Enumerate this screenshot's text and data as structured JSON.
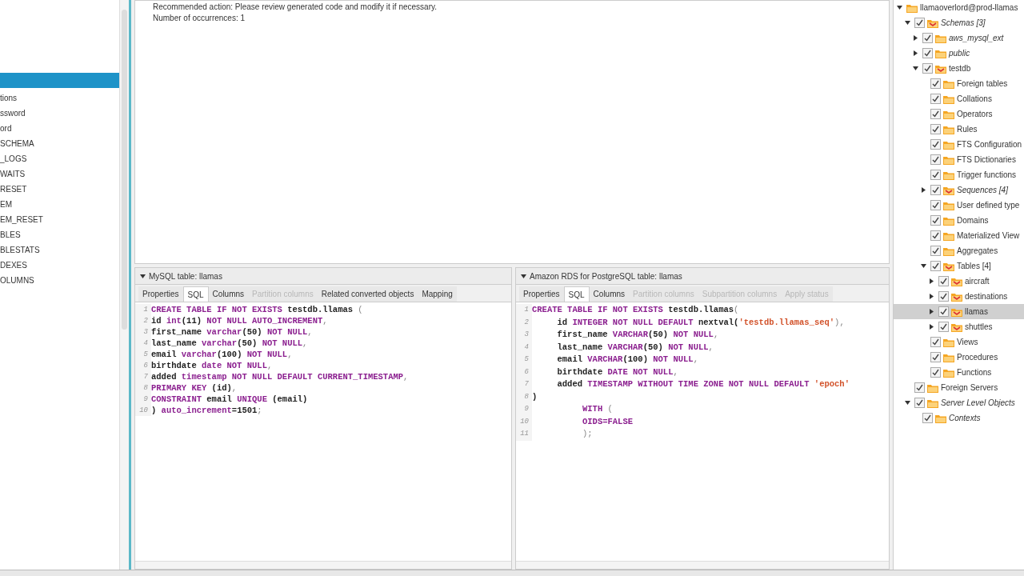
{
  "left_list": {
    "items": [
      {
        "selected": true
      },
      {
        "label": "tions",
        "selected": false
      },
      {
        "label": "ssword",
        "selected": false
      },
      {
        "label": "ord",
        "selected": false
      },
      {
        "label": "SCHEMA",
        "selected": false
      },
      {
        "label": "_LOGS",
        "selected": false
      },
      {
        "label": "WAITS",
        "selected": false
      },
      {
        "label": "RESET",
        "selected": false
      },
      {
        "label": "EM",
        "selected": false
      },
      {
        "label": "EM_RESET",
        "selected": false
      },
      {
        "label": "BLES",
        "selected": false
      },
      {
        "label": "BLESTATS",
        "selected": false
      },
      {
        "label": "DEXES",
        "selected": false
      },
      {
        "label": "OLUMNS",
        "selected": false
      }
    ]
  },
  "message": {
    "lines": [
      "Recommended action: Please review generated code and modify it if necessary.",
      "Number of occurrences: 1"
    ]
  },
  "source_panel": {
    "title": "MySQL table: llamas",
    "expanded": true,
    "tabs": [
      {
        "label": "Properties",
        "selected": false,
        "disabled": false
      },
      {
        "label": "SQL",
        "selected": true,
        "disabled": false
      },
      {
        "label": "Columns",
        "selected": false,
        "disabled": false
      },
      {
        "label": "Partition columns",
        "selected": false,
        "disabled": true
      },
      {
        "label": "Related converted objects",
        "selected": false,
        "disabled": false
      },
      {
        "label": "Mapping",
        "selected": false,
        "disabled": false
      }
    ],
    "code": [
      {
        "number": "1",
        "tokens": [
          {
            "text": "CREATE TABLE IF NOT EXISTS",
            "kind": "keyword"
          },
          {
            "text": " testdb.llamas ",
            "kind": "ident"
          },
          {
            "text": "(",
            "kind": "punct"
          }
        ]
      },
      {
        "number": "2",
        "tokens": [
          {
            "text": "id ",
            "kind": "ident"
          },
          {
            "text": "int",
            "kind": "keyword"
          },
          {
            "text": "(11) ",
            "kind": "ident"
          },
          {
            "text": "NOT NULL AUTO_INCREMENT",
            "kind": "keyword"
          },
          {
            "text": ",",
            "kind": "punct"
          }
        ]
      },
      {
        "number": "3",
        "tokens": [
          {
            "text": "first_name ",
            "kind": "ident"
          },
          {
            "text": "varchar",
            "kind": "keyword"
          },
          {
            "text": "(50) ",
            "kind": "ident"
          },
          {
            "text": "NOT NULL",
            "kind": "keyword"
          },
          {
            "text": ",",
            "kind": "punct"
          }
        ]
      },
      {
        "number": "4",
        "tokens": [
          {
            "text": "last_name ",
            "kind": "ident"
          },
          {
            "text": "varchar",
            "kind": "keyword"
          },
          {
            "text": "(50) ",
            "kind": "ident"
          },
          {
            "text": "NOT NULL",
            "kind": "keyword"
          },
          {
            "text": ",",
            "kind": "punct"
          }
        ]
      },
      {
        "number": "5",
        "tokens": [
          {
            "text": "email ",
            "kind": "ident"
          },
          {
            "text": "varchar",
            "kind": "keyword"
          },
          {
            "text": "(100) ",
            "kind": "ident"
          },
          {
            "text": "NOT NULL",
            "kind": "keyword"
          },
          {
            "text": ",",
            "kind": "punct"
          }
        ]
      },
      {
        "number": "6",
        "tokens": [
          {
            "text": "birthdate ",
            "kind": "ident"
          },
          {
            "text": "date NOT NULL",
            "kind": "keyword"
          },
          {
            "text": ",",
            "kind": "punct"
          }
        ]
      },
      {
        "number": "7",
        "tokens": [
          {
            "text": "added ",
            "kind": "ident"
          },
          {
            "text": "timestamp NOT NULL DEFAULT CURRENT_TIMESTAMP",
            "kind": "keyword"
          },
          {
            "text": ",",
            "kind": "punct"
          }
        ]
      },
      {
        "number": "8",
        "tokens": [
          {
            "text": "PRIMARY KEY",
            "kind": "keyword"
          },
          {
            "text": " (id)",
            "kind": "ident"
          },
          {
            "text": ",",
            "kind": "punct"
          }
        ]
      },
      {
        "number": "9",
        "tokens": [
          {
            "text": "CONSTRAINT",
            "kind": "keyword"
          },
          {
            "text": " email ",
            "kind": "ident"
          },
          {
            "text": "UNIQUE",
            "kind": "keyword"
          },
          {
            "text": " (email)",
            "kind": "ident"
          }
        ]
      },
      {
        "number": "10",
        "tokens": [
          {
            "text": ") ",
            "kind": "ident"
          },
          {
            "text": "auto_increment",
            "kind": "keyword"
          },
          {
            "text": "=1501",
            "kind": "ident"
          },
          {
            "text": ";",
            "kind": "punct"
          }
        ]
      }
    ]
  },
  "target_panel": {
    "title": "Amazon RDS for PostgreSQL table: llamas",
    "expanded": true,
    "tabs": [
      {
        "label": "Properties",
        "selected": false,
        "disabled": false
      },
      {
        "label": "SQL",
        "selected": true,
        "disabled": false
      },
      {
        "label": "Columns",
        "selected": false,
        "disabled": false
      },
      {
        "label": "Partition columns",
        "selected": false,
        "disabled": true
      },
      {
        "label": "Subpartition columns",
        "selected": false,
        "disabled": true
      },
      {
        "label": "Apply status",
        "selected": false,
        "disabled": true
      }
    ],
    "code": [
      {
        "number": "1",
        "tokens": [
          {
            "text": "CREATE TABLE IF NOT EXISTS",
            "kind": "keyword"
          },
          {
            "text": " testdb.llamas",
            "kind": "ident"
          },
          {
            "text": "(",
            "kind": "punct"
          }
        ]
      },
      {
        "number": "2",
        "tokens": [
          {
            "text": "     id ",
            "kind": "ident"
          },
          {
            "text": "INTEGER NOT NULL DEFAULT",
            "kind": "keyword"
          },
          {
            "text": " nextval(",
            "kind": "ident"
          },
          {
            "text": "'testdb.llamas_seq'",
            "kind": "string"
          },
          {
            "text": "),",
            "kind": "punct"
          }
        ]
      },
      {
        "number": "3",
        "tokens": [
          {
            "text": "     first_name ",
            "kind": "ident"
          },
          {
            "text": "VARCHAR",
            "kind": "keyword"
          },
          {
            "text": "(50) ",
            "kind": "ident"
          },
          {
            "text": "NOT NULL",
            "kind": "keyword"
          },
          {
            "text": ",",
            "kind": "punct"
          }
        ]
      },
      {
        "number": "4",
        "tokens": [
          {
            "text": "     last_name ",
            "kind": "ident"
          },
          {
            "text": "VARCHAR",
            "kind": "keyword"
          },
          {
            "text": "(50) ",
            "kind": "ident"
          },
          {
            "text": "NOT NULL",
            "kind": "keyword"
          },
          {
            "text": ",",
            "kind": "punct"
          }
        ]
      },
      {
        "number": "5",
        "tokens": [
          {
            "text": "     email ",
            "kind": "ident"
          },
          {
            "text": "VARCHAR",
            "kind": "keyword"
          },
          {
            "text": "(100) ",
            "kind": "ident"
          },
          {
            "text": "NOT NULL",
            "kind": "keyword"
          },
          {
            "text": ",",
            "kind": "punct"
          }
        ]
      },
      {
        "number": "6",
        "tokens": [
          {
            "text": "     birthdate ",
            "kind": "ident"
          },
          {
            "text": "DATE NOT NULL",
            "kind": "keyword"
          },
          {
            "text": ",",
            "kind": "punct"
          }
        ]
      },
      {
        "number": "7",
        "tokens": [
          {
            "text": "     added ",
            "kind": "ident"
          },
          {
            "text": "TIMESTAMP WITHOUT TIME ZONE NOT NULL DEFAULT",
            "kind": "keyword"
          },
          {
            "text": " 'epoch'",
            "kind": "string"
          }
        ]
      },
      {
        "number": "8",
        "tokens": [
          {
            "text": ")",
            "kind": "ident"
          }
        ]
      },
      {
        "number": "9",
        "tokens": [
          {
            "text": "          WITH",
            "kind": "keyword"
          },
          {
            "text": " (",
            "kind": "punct"
          }
        ]
      },
      {
        "number": "10",
        "tokens": [
          {
            "text": "          OIDS=FALSE",
            "kind": "keyword"
          }
        ]
      },
      {
        "number": "11",
        "tokens": [
          {
            "text": "          );",
            "kind": "punct"
          }
        ]
      }
    ]
  },
  "tree": [
    {
      "label": "llamaoverlord@prod-llamas",
      "expanded": true,
      "converted": false,
      "italic": false,
      "selected": false,
      "children": [
        {
          "label": "Schemas [3]",
          "expanded": true,
          "checked": true,
          "converted": true,
          "italic": true,
          "selected": false,
          "children": [
            {
              "label": "aws_mysql_ext",
              "expanded": false,
              "checked": true,
              "converted": false,
              "italic": true,
              "selected": false
            },
            {
              "label": "public",
              "expanded": false,
              "checked": true,
              "converted": false,
              "italic": true,
              "selected": false
            },
            {
              "label": "testdb",
              "expanded": true,
              "checked": true,
              "converted": true,
              "italic": false,
              "selected": false,
              "children": [
                {
                  "label": "Foreign tables",
                  "checked": true,
                  "converted": false,
                  "italic": false,
                  "selected": false
                },
                {
                  "label": "Collations",
                  "checked": true,
                  "converted": false,
                  "italic": false,
                  "selected": false
                },
                {
                  "label": "Operators",
                  "checked": true,
                  "converted": false,
                  "italic": false,
                  "selected": false
                },
                {
                  "label": "Rules",
                  "checked": true,
                  "converted": false,
                  "italic": false,
                  "selected": false
                },
                {
                  "label": "FTS Configuration",
                  "checked": true,
                  "converted": false,
                  "italic": false,
                  "selected": false
                },
                {
                  "label": "FTS Dictionaries",
                  "checked": true,
                  "converted": false,
                  "italic": false,
                  "selected": false
                },
                {
                  "label": "Trigger functions",
                  "checked": true,
                  "converted": false,
                  "italic": false,
                  "selected": false
                },
                {
                  "label": "Sequences [4]",
                  "expanded": false,
                  "checked": true,
                  "converted": true,
                  "italic": true,
                  "selected": false
                },
                {
                  "label": "User defined type",
                  "checked": true,
                  "converted": false,
                  "italic": false,
                  "selected": false
                },
                {
                  "label": "Domains",
                  "checked": true,
                  "converted": false,
                  "italic": false,
                  "selected": false
                },
                {
                  "label": "Materialized View",
                  "checked": true,
                  "converted": false,
                  "italic": false,
                  "selected": false
                },
                {
                  "label": "Aggregates",
                  "checked": true,
                  "converted": false,
                  "italic": false,
                  "selected": false
                },
                {
                  "label": "Tables [4]",
                  "expanded": true,
                  "checked": true,
                  "converted": true,
                  "italic": false,
                  "selected": false,
                  "children": [
                    {
                      "label": "aircraft",
                      "expanded": false,
                      "checked": true,
                      "converted": true,
                      "italic": false,
                      "selected": false
                    },
                    {
                      "label": "destinations",
                      "expanded": false,
                      "checked": true,
                      "converted": true,
                      "italic": false,
                      "selected": false
                    },
                    {
                      "label": "llamas",
                      "expanded": false,
                      "checked": true,
                      "converted": true,
                      "italic": false,
                      "selected": true
                    },
                    {
                      "label": "shuttles",
                      "expanded": false,
                      "checked": true,
                      "converted": true,
                      "italic": false,
                      "selected": false
                    }
                  ]
                },
                {
                  "label": "Views",
                  "checked": true,
                  "converted": false,
                  "italic": false,
                  "selected": false
                },
                {
                  "label": "Procedures",
                  "checked": true,
                  "converted": false,
                  "italic": false,
                  "selected": false
                },
                {
                  "label": "Functions",
                  "checked": true,
                  "converted": false,
                  "italic": false,
                  "selected": false
                }
              ]
            }
          ]
        },
        {
          "label": "Foreign Servers",
          "checked": true,
          "converted": false,
          "italic": false,
          "selected": false
        },
        {
          "label": "Server Level Objects",
          "expanded": true,
          "checked": true,
          "converted": false,
          "italic": true,
          "selected": false,
          "children": [
            {
              "label": "Contexts",
              "checked": true,
              "converted": false,
              "italic": true,
              "selected": false
            }
          ]
        }
      ]
    }
  ]
}
